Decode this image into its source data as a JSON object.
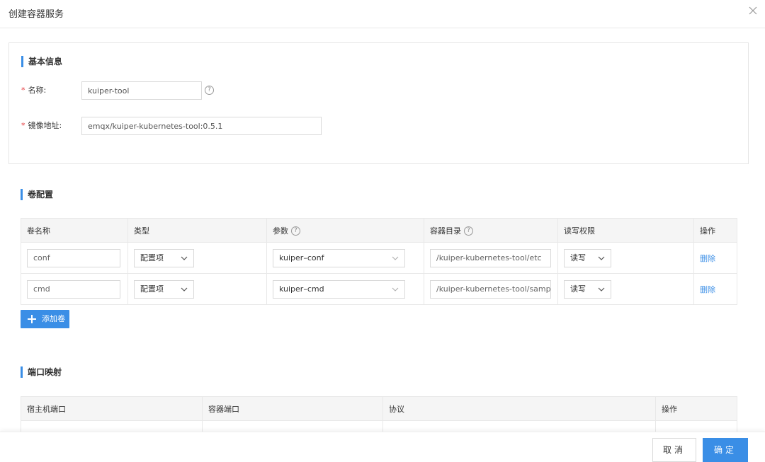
{
  "dialog": {
    "title": "创建容器服务"
  },
  "basic": {
    "section_title": "基本信息",
    "name_label": "名称:",
    "name_value": "kuiper-tool",
    "image_label": "镜像地址:",
    "image_value": "emqx/kuiper-kubernetes-tool:0.5.1",
    "required_mark": "*",
    "help_glyph": "?"
  },
  "volumes": {
    "section_title": "卷配置",
    "headers": [
      "卷名称",
      "类型",
      "参数",
      "容器目录",
      "读写权限",
      "操作"
    ],
    "rows": [
      {
        "name": "conf",
        "type": "配置项",
        "param": "kuiper–conf",
        "dir": "/kuiper-kubernetes-tool/etc",
        "perm": "读写",
        "action": "删除"
      },
      {
        "name": "cmd",
        "type": "配置项",
        "param": "kuiper–cmd",
        "dir": "/kuiper-kubernetes-tool/sample",
        "perm": "读写",
        "action": "删除"
      }
    ],
    "add_label": "添加卷"
  },
  "ports": {
    "section_title": "端口映射",
    "headers": [
      "宿主机端口",
      "容器端口",
      "协议",
      "操作"
    ]
  },
  "footer": {
    "cancel_label": "取消",
    "ok_label": "确定"
  },
  "colors": {
    "accent": "#3a8ee6",
    "required": "#e4393c",
    "border": "#d9d9d9",
    "header_bg": "#f5f5f5"
  },
  "icons": {
    "close": "close-icon",
    "help": "help-icon",
    "chevron": "chevron-down-icon",
    "plus": "plus-icon"
  }
}
